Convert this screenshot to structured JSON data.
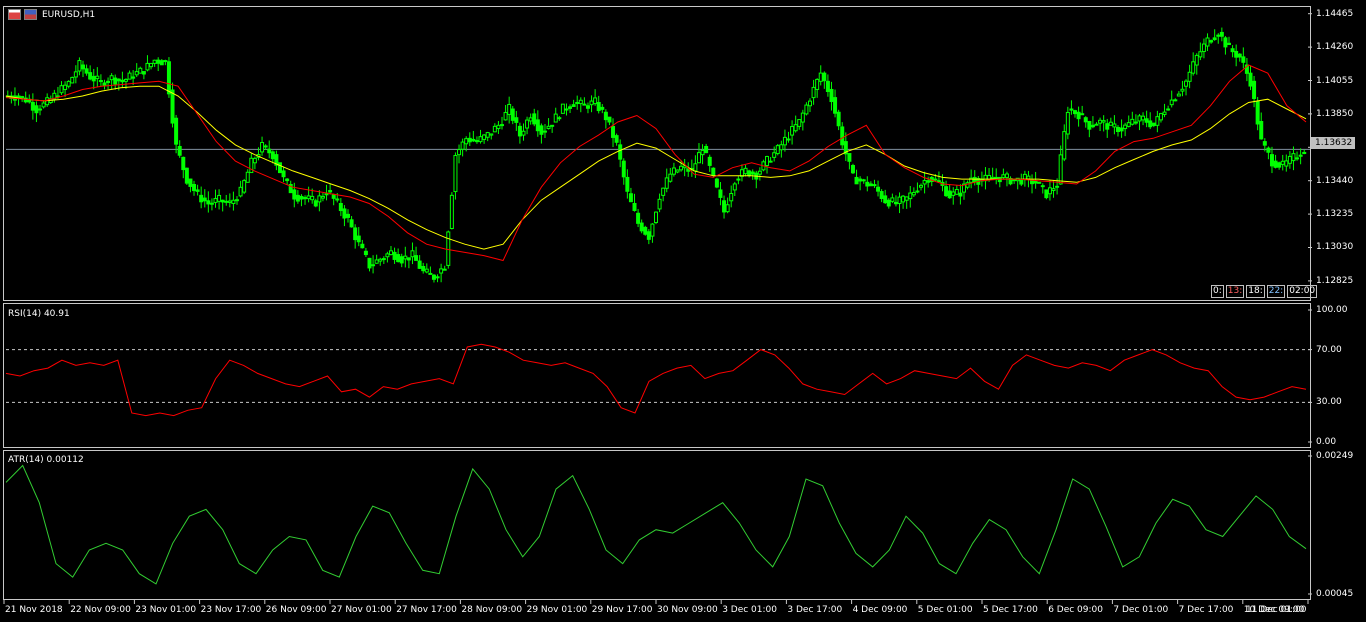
{
  "chart_title": "EURUSD,H1",
  "rsi_label": "RSI(14) 40.91",
  "atr_label": "ATR(14) 0.00112",
  "current_price": "1.13632",
  "clock_cells": [
    "0:",
    "13:",
    "18:",
    "22:",
    "02:00"
  ],
  "colors": {
    "bull_candle": "#00ff00",
    "bear_candle": "#00ff00",
    "ma_fast": "#ff0000",
    "ma_slow": "#ffff00",
    "rsi": "#ff0000",
    "atr": "#32cd32",
    "grid": "#c8c8c8"
  },
  "icons": [
    "window-icon-1",
    "window-icon-2"
  ],
  "chart_data": [
    {
      "type": "candlestick",
      "title": "EURUSD,H1",
      "yticks": [
        "1.14465",
        "1.14260",
        "1.14055",
        "1.13850",
        "1.13645",
        "1.13440",
        "1.13235",
        "1.13030",
        "1.12825"
      ],
      "ylim": [
        1.1272,
        1.145
      ],
      "x": [
        "21 Nov 2018",
        "22 Nov 09:00",
        "23 Nov 01:00",
        "23 Nov 17:00",
        "26 Nov 09:00",
        "27 Nov 01:00",
        "27 Nov 17:00",
        "28 Nov 09:00",
        "29 Nov 01:00",
        "29 Nov 17:00",
        "30 Nov 09:00",
        "3 Dec 01:00",
        "3 Dec 17:00",
        "4 Dec 09:00",
        "5 Dec 01:00",
        "5 Dec 17:00",
        "6 Dec 09:00",
        "7 Dec 01:00",
        "7 Dec 17:00",
        "10 Dec 09:00",
        "11 Dec 01:00"
      ],
      "close_path": [
        1.1396,
        1.1394,
        1.1388,
        1.1392,
        1.1398,
        1.1404,
        1.1415,
        1.1408,
        1.1404,
        1.1407,
        1.1405,
        1.1409,
        1.1412,
        1.1418,
        1.1417,
        1.1365,
        1.1345,
        1.1335,
        1.133,
        1.1332,
        1.133,
        1.1337,
        1.1355,
        1.1365,
        1.136,
        1.1345,
        1.1335,
        1.1333,
        1.1331,
        1.1338,
        1.133,
        1.132,
        1.1305,
        1.1292,
        1.1296,
        1.13,
        1.1296,
        1.1298,
        1.1288,
        1.1285,
        1.1292,
        1.136,
        1.137,
        1.1368,
        1.1372,
        1.1378,
        1.1388,
        1.1372,
        1.1385,
        1.1374,
        1.138,
        1.1388,
        1.1392,
        1.139,
        1.1392,
        1.1383,
        1.1366,
        1.1336,
        1.1318,
        1.131,
        1.1335,
        1.1348,
        1.1352,
        1.135,
        1.1365,
        1.1345,
        1.1325,
        1.1345,
        1.135,
        1.1348,
        1.1356,
        1.1363,
        1.1372,
        1.138,
        1.1395,
        1.141,
        1.1395,
        1.1368,
        1.1346,
        1.1343,
        1.134,
        1.1332,
        1.133,
        1.1333,
        1.134,
        1.1346,
        1.1343,
        1.1335,
        1.1337,
        1.1346,
        1.1344,
        1.1346,
        1.1346,
        1.1344,
        1.1345,
        1.1343,
        1.1336,
        1.1342,
        1.1388,
        1.1385,
        1.1378,
        1.138,
        1.1377,
        1.1376,
        1.138,
        1.1382,
        1.1378,
        1.1388,
        1.1396,
        1.1405,
        1.142,
        1.143,
        1.1435,
        1.1425,
        1.142,
        1.1405,
        1.1368,
        1.1356,
        1.1353,
        1.1358,
        1.1363
      ],
      "ma_fast_path": [
        1.1395,
        1.1394,
        1.1393,
        1.1396,
        1.14,
        1.1402,
        1.1403,
        1.1404,
        1.1405,
        1.1402,
        1.1385,
        1.1368,
        1.1356,
        1.135,
        1.1345,
        1.134,
        1.1338,
        1.1336,
        1.1334,
        1.133,
        1.1322,
        1.1312,
        1.1305,
        1.1302,
        1.13,
        1.1298,
        1.1295,
        1.132,
        1.134,
        1.1355,
        1.1365,
        1.1372,
        1.138,
        1.1384,
        1.1376,
        1.136,
        1.1348,
        1.1346,
        1.1352,
        1.1355,
        1.1352,
        1.135,
        1.1356,
        1.1365,
        1.1372,
        1.1378,
        1.136,
        1.1352,
        1.1346,
        1.1342,
        1.1341,
        1.1344,
        1.1345,
        1.1345,
        1.1344,
        1.1343,
        1.1342,
        1.135,
        1.1362,
        1.1368,
        1.137,
        1.1374,
        1.1378,
        1.139,
        1.1405,
        1.1415,
        1.141,
        1.139,
        1.138
      ],
      "ma_slow_path": [
        1.1396,
        1.1394,
        1.1393,
        1.1394,
        1.1396,
        1.1399,
        1.1401,
        1.1402,
        1.1402,
        1.1396,
        1.1386,
        1.1375,
        1.1366,
        1.136,
        1.1355,
        1.135,
        1.1346,
        1.1342,
        1.1338,
        1.1333,
        1.1327,
        1.132,
        1.1314,
        1.1309,
        1.1305,
        1.1302,
        1.1305,
        1.132,
        1.1332,
        1.134,
        1.1348,
        1.1356,
        1.1362,
        1.1367,
        1.1364,
        1.1357,
        1.135,
        1.1347,
        1.1347,
        1.1347,
        1.1346,
        1.1347,
        1.135,
        1.1356,
        1.1362,
        1.1366,
        1.136,
        1.1353,
        1.1349,
        1.1346,
        1.1345,
        1.1345,
        1.1345,
        1.1345,
        1.1345,
        1.1344,
        1.1343,
        1.1346,
        1.1352,
        1.1357,
        1.1362,
        1.1366,
        1.1369,
        1.1376,
        1.1385,
        1.1392,
        1.1394,
        1.1388,
        1.1382
      ]
    },
    {
      "type": "line",
      "title": "RSI(14) 40.91",
      "yticks": [
        "100.00",
        "70.00",
        "30.00",
        "0.00"
      ],
      "ylim": [
        0,
        100
      ],
      "levels": [
        70,
        30
      ],
      "values": [
        52,
        50,
        54,
        56,
        62,
        58,
        60,
        58,
        62,
        22,
        20,
        22,
        20,
        24,
        26,
        48,
        62,
        58,
        52,
        48,
        44,
        42,
        46,
        50,
        38,
        40,
        34,
        42,
        40,
        44,
        46,
        48,
        44,
        72,
        74,
        72,
        68,
        62,
        60,
        58,
        60,
        56,
        52,
        42,
        26,
        22,
        46,
        52,
        56,
        58,
        48,
        52,
        54,
        62,
        70,
        66,
        56,
        44,
        40,
        38,
        36,
        44,
        52,
        44,
        48,
        54,
        52,
        50,
        48,
        56,
        46,
        40,
        58,
        66,
        62,
        58,
        56,
        60,
        58,
        54,
        62,
        66,
        70,
        66,
        60,
        56,
        54,
        42,
        34,
        32,
        34,
        38,
        42,
        40
      ]
    },
    {
      "type": "line",
      "title": "ATR(14) 0.00112",
      "yticks": [
        "0.00249",
        "0.00045"
      ],
      "ylim": [
        0.00045,
        0.00249
      ],
      "values": [
        0.0021,
        0.00235,
        0.0018,
        0.0009,
        0.0007,
        0.0011,
        0.0012,
        0.0011,
        0.00075,
        0.0006,
        0.0012,
        0.0016,
        0.0017,
        0.0014,
        0.0009,
        0.00075,
        0.0011,
        0.0013,
        0.00125,
        0.0008,
        0.0007,
        0.0013,
        0.00175,
        0.00165,
        0.0012,
        0.0008,
        0.00075,
        0.0016,
        0.0023,
        0.002,
        0.0014,
        0.001,
        0.0013,
        0.002,
        0.0022,
        0.0017,
        0.0011,
        0.0009,
        0.00125,
        0.0014,
        0.00135,
        0.0015,
        0.00165,
        0.0018,
        0.0015,
        0.0011,
        0.00085,
        0.0013,
        0.00215,
        0.00205,
        0.0015,
        0.00105,
        0.00085,
        0.0011,
        0.0016,
        0.00135,
        0.0009,
        0.00075,
        0.0012,
        0.00155,
        0.0014,
        0.001,
        0.00075,
        0.0014,
        0.00215,
        0.002,
        0.00145,
        0.00085,
        0.001,
        0.0015,
        0.00185,
        0.00175,
        0.0014,
        0.0013,
        0.0016,
        0.0019,
        0.0017,
        0.0013,
        0.00112
      ]
    }
  ]
}
